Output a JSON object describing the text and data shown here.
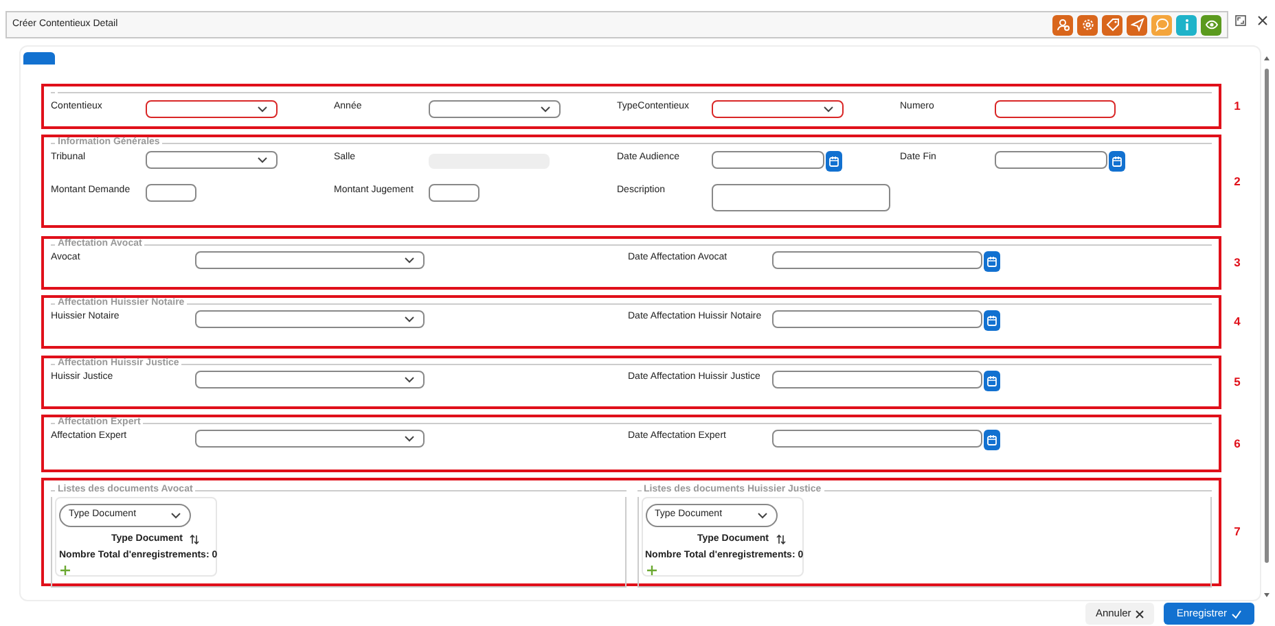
{
  "dialog": {
    "title": "Créer Contentieux Detail",
    "toolbar": [
      {
        "color": "#d9661c"
      },
      {
        "color": "#d9661c"
      },
      {
        "color": "#d9661c"
      },
      {
        "color": "#d9661c"
      },
      {
        "color": "#f4a53c"
      },
      {
        "color": "#1fb3c9"
      },
      {
        "color": "#5b9a1e"
      }
    ]
  },
  "sections": [
    {
      "number": "1",
      "kind": "grid",
      "fields": [
        {
          "label": "Contentieux",
          "kind": "select",
          "invalid": true
        },
        {
          "label": "Année",
          "kind": "select",
          "invalid": false
        },
        {
          "label": "TypeContentieux",
          "kind": "select",
          "invalid": true
        },
        {
          "label": "Numero",
          "kind": "text",
          "invalid": true
        }
      ]
    },
    {
      "number": "2",
      "legend": "Information Générales",
      "kind": "grid",
      "fields": [
        {
          "label": "Tribunal",
          "kind": "select",
          "invalid": false
        },
        {
          "label": "Salle",
          "kind": "disabled",
          "invalid": false
        },
        {
          "label": "Date Audience",
          "kind": "date",
          "invalid": false
        },
        {
          "label": "Date Fin",
          "kind": "date",
          "invalid": false
        },
        {
          "label": "Montant Demande",
          "kind": "short",
          "invalid": false
        },
        {
          "label": "Montant Jugement",
          "kind": "short",
          "invalid": false
        },
        {
          "label": "Description",
          "kind": "textarea",
          "invalid": false
        }
      ]
    },
    {
      "number": "3",
      "legend": "Affectation Avocat",
      "kind": "pair",
      "fields": [
        {
          "label": "Avocat",
          "kind": "select",
          "invalid": false
        },
        {
          "label": "Date Affectation Avocat",
          "kind": "date",
          "invalid": false
        }
      ]
    },
    {
      "number": "4",
      "legend": "Affectation Huissier Notaire",
      "kind": "pair",
      "fields": [
        {
          "label": "Huissier Notaire",
          "kind": "select",
          "invalid": false
        },
        {
          "label": "Date Affectation Huissir Notaire",
          "kind": "date",
          "invalid": false
        }
      ]
    },
    {
      "number": "5",
      "legend": "Affectation Huissir Justice",
      "kind": "pair",
      "fields": [
        {
          "label": "Huissir Justice",
          "kind": "select",
          "invalid": false
        },
        {
          "label": "Date Affectation Huissir Justice",
          "kind": "date",
          "invalid": false
        }
      ]
    },
    {
      "number": "6",
      "legend": "Affectation Expert",
      "kind": "pair",
      "fields": [
        {
          "label": "Affectation Expert",
          "kind": "select",
          "invalid": false
        },
        {
          "label": "Date Affectation Expert",
          "kind": "date",
          "invalid": false
        }
      ]
    },
    {
      "number": "7",
      "kind": "documents",
      "panels": [
        {
          "legend": "Listes des documents Avocat",
          "select_value": "Type Document",
          "column": "Type Document",
          "total": "Nombre Total d'enregistrements: 0"
        },
        {
          "legend": "Listes des documents Huissier Justice",
          "select_value": "Type Document",
          "column": "Type Document",
          "total": "Nombre Total d'enregistrements: 0"
        }
      ]
    }
  ],
  "footer": [
    {
      "label": "Annuler",
      "kind": "cancel"
    },
    {
      "label": "Enregistrer",
      "kind": "save"
    }
  ]
}
